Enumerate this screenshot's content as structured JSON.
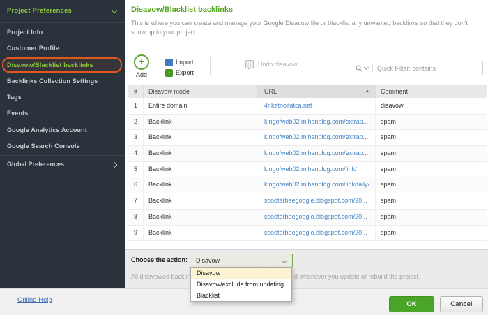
{
  "colors": {
    "sidebar_bg": "#2a333c",
    "accent_green": "#8dc63f",
    "title_green": "#55a321",
    "highlight_orange": "#e2581c",
    "link_blue": "#4a86c8",
    "ok_green": "#4aa427",
    "import_blue": "#3c7cc0",
    "export_green": "#4b9327",
    "dropdown_highlight": "#fcf3d2"
  },
  "icons": {
    "add_plus": "+",
    "import_arrow": "↓",
    "export_arrow": "↑",
    "check": "✓",
    "sort_ascending": "▲"
  },
  "sidebar": {
    "header_label": "Project Preferences",
    "items": [
      {
        "label": "Project Info"
      },
      {
        "label": "Customer Profile"
      },
      {
        "label": "Disavow/Blacklist backlinks",
        "selected": true
      },
      {
        "label": "Backlinks Collection Settings"
      },
      {
        "label": "Tags"
      },
      {
        "label": "Events"
      },
      {
        "label": "Google Analytics Account"
      },
      {
        "label": "Google Search Console"
      }
    ],
    "global_label": "Global Preferences"
  },
  "main": {
    "title": "Disavow/Blacklist backlinks",
    "description": "This is where you can create and manage your Google Disavow file or blacklist any unwanted backlinks so that they don't show up in your project.",
    "toolbar": {
      "add_label": "Add",
      "import_label": "Import",
      "export_label": "Export",
      "undo_label": "Undo disavow",
      "filter_placeholder": "Quick Filter: contains"
    },
    "table": {
      "columns": {
        "num": "#",
        "mode": "Disavow mode",
        "url": "URL",
        "comment": "Comment"
      },
      "rows": [
        {
          "num": "1",
          "mode": "Entire domain",
          "url": "4r.ketnoitatca.net",
          "comment": "disavow"
        },
        {
          "num": "2",
          "mode": "Backlink",
          "url": "kingofweb02.mihanblog.com/extrap...",
          "comment": "spam"
        },
        {
          "num": "3",
          "mode": "Backlink",
          "url": "kingofweb02.mihanblog.com/extrap...",
          "comment": "spam"
        },
        {
          "num": "4",
          "mode": "Backlink",
          "url": "kingofweb02.mihanblog.com/extrap...",
          "comment": "spam"
        },
        {
          "num": "5",
          "mode": "Backlink",
          "url": "kingofweb02.mihanblog.com/link/",
          "comment": "spam"
        },
        {
          "num": "6",
          "mode": "Backlink",
          "url": "kingofweb02.mihanblog.com/linkdaily/",
          "comment": "spam"
        },
        {
          "num": "7",
          "mode": "Backlink",
          "url": "scooterbeegoogle.blogspot.com/20...",
          "comment": "spam"
        },
        {
          "num": "8",
          "mode": "Backlink",
          "url": "scooterbeegoogle.blogspot.com/20...",
          "comment": "spam"
        },
        {
          "num": "9",
          "mode": "Backlink",
          "url": "scooterbeegoogle.blogspot.com/20...",
          "comment": "spam"
        }
      ]
    },
    "action": {
      "label": "Choose the action:",
      "selected": "Disavow",
      "options": [
        "Disavow",
        "Disavow/exclude from updating",
        "Blacklist"
      ],
      "hint_left": "All disavowed backlink",
      "hint_right": "d whenever you update or rebuild the project."
    }
  },
  "footer": {
    "help_link": "Online Help",
    "ok_label": "OK",
    "cancel_label": "Cancel"
  }
}
